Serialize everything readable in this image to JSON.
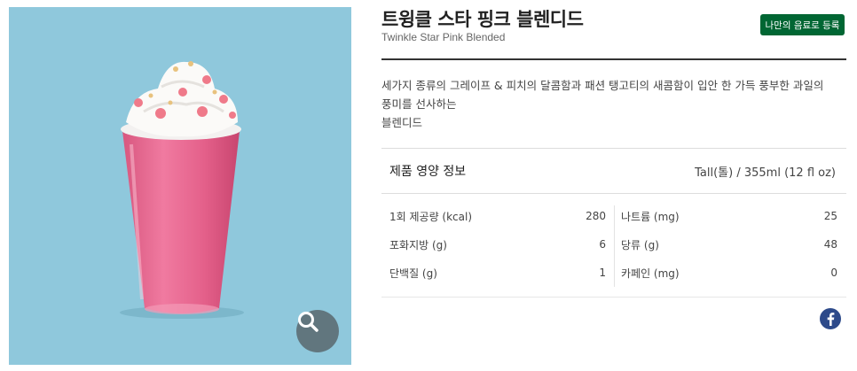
{
  "product": {
    "title_ko": "트윙클 스타 핑크 블렌디드",
    "title_en": "Twinkle Star Pink Blended",
    "register_label": "나만의 음료로 등록",
    "description_lines": [
      "세가지 종류의 그레이프 & 피치의 달콤함과 패션 탱고티의 새콤함이 입안 한 가득 풍부한 과일의",
      "풍미를 선사하는",
      "블렌디드"
    ]
  },
  "nutrition": {
    "title": "제품 영양 정보",
    "serving": "Tall(톨) / 355ml (12 fl oz)",
    "left": [
      {
        "label": "1회 제공량 (kcal)",
        "value": "280"
      },
      {
        "label": "포화지방 (g)",
        "value": "6"
      },
      {
        "label": "단백질 (g)",
        "value": "1"
      }
    ],
    "right": [
      {
        "label": "나트륨 (mg)",
        "value": "25"
      },
      {
        "label": "당류 (g)",
        "value": "48"
      },
      {
        "label": "카페인 (mg)",
        "value": "0"
      }
    ]
  },
  "icons": {
    "zoom": "magnifier-icon",
    "share": "facebook-icon"
  },
  "colors": {
    "image_background": "#8fc8dc",
    "register_button": "#006633",
    "facebook": "#2d4a8a",
    "drink_pink": "#e85c8c"
  }
}
